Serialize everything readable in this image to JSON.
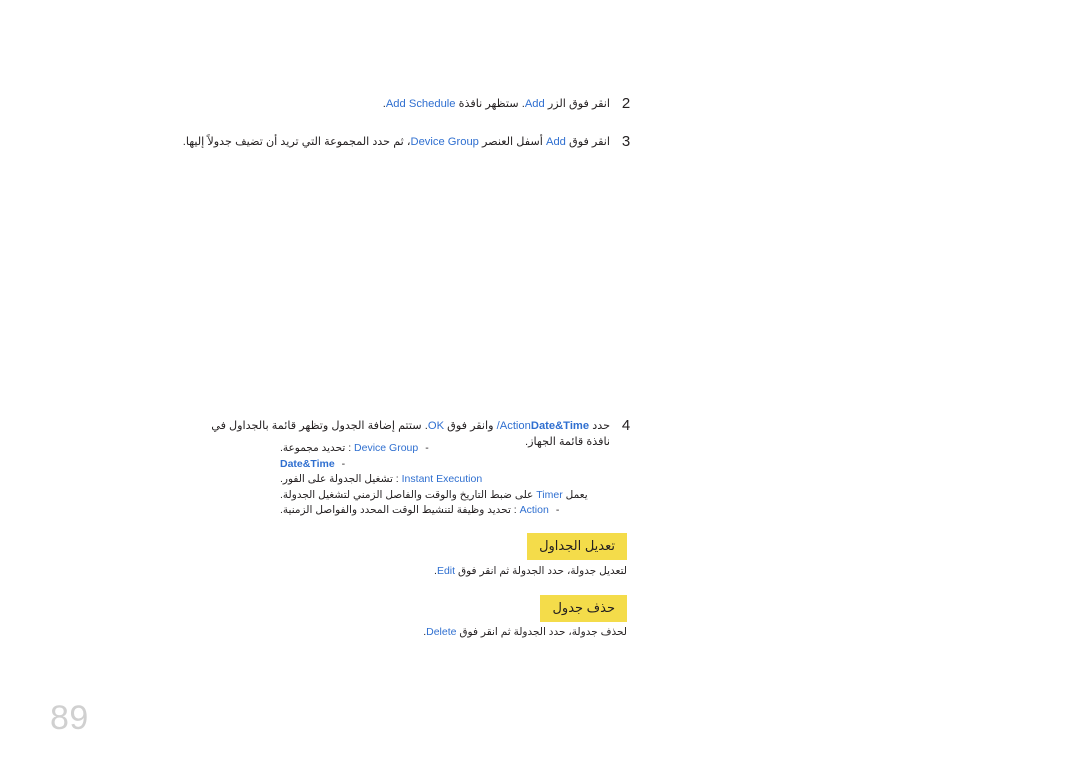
{
  "document": {
    "language": "ar",
    "direction": "rtl",
    "page_number": "89",
    "accent_color": "#2f6fd0",
    "highlight_color": "#f4dc4a",
    "text_color": "#231f20"
  },
  "steps": [
    {
      "number": "2",
      "pre": "انقر فوق الزر",
      "term1": "Add",
      "mid": ". ستظهر نافذة",
      "term2": "Add Schedule",
      "post": "."
    },
    {
      "number": "3",
      "pre": "انقر فوق",
      "term1": "Add",
      "mid": "أسفل العنصر",
      "term2": "Device Group",
      "post": "، ثم حدد المجموعة التي تريد أن تضيف جدولاً إليها."
    },
    {
      "number": "4",
      "pre": "حدد",
      "term1": "Date&Time",
      "term1b": "/Action",
      "mid": "وانقر فوق",
      "term2": "OK",
      "post": ". ستتم إضافة الجدول وتظهر قائمة بالجداول في نافذة قائمة الجهاز."
    }
  ],
  "bullets": [
    {
      "mark": "-",
      "term": "Device Group",
      "separator": ":",
      "text": "تحديد مجموعة.",
      "bold": false
    },
    {
      "mark": "-",
      "term": "Date&Time",
      "separator": "",
      "text": "",
      "bold": true
    },
    {
      "mark": "",
      "term": "Instant Execution",
      "separator": ":",
      "text": "تشغيل الجدولة على الفور.",
      "bold": false
    },
    {
      "mark": "",
      "term": "Timer",
      "separator": "",
      "text": "",
      "bold": false,
      "sentence_before": "يعمل",
      "sentence_after": "على ضبط التاريخ والوقت والفاصل الزمني لتشغيل الجدولة."
    },
    {
      "mark": "-",
      "term": "Action",
      "separator": ":",
      "text": "تحديد وظيفة لتنشيط الوقت المحدد والفواصل الزمنية.",
      "bold": false
    }
  ],
  "sections": [
    {
      "heading": "تعديل الجداول",
      "body_pre": "لتعديل جدولة، حدد الجدولة ثم انقر فوق",
      "body_term": "Edit",
      "body_post": "."
    },
    {
      "heading": "حذف جدول",
      "body_pre": "لحذف جدولة، حدد الجدولة ثم انقر فوق",
      "body_term": "Delete",
      "body_post": "."
    }
  ]
}
